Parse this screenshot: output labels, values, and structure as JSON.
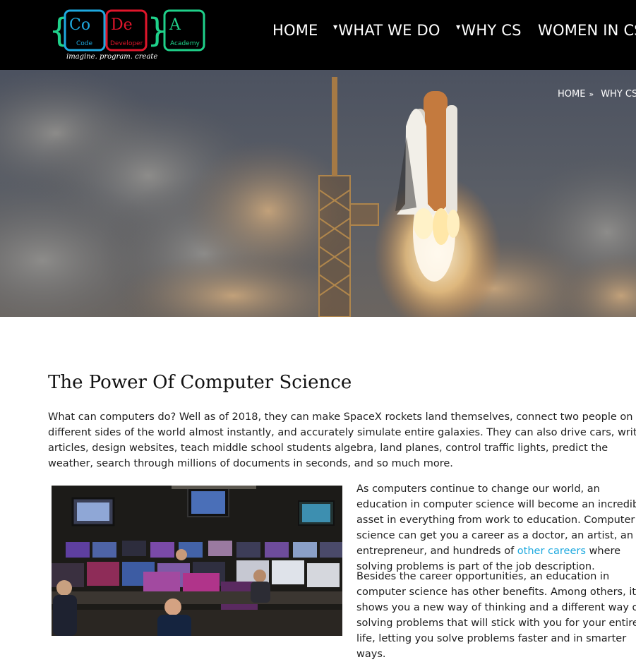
{
  "header": {
    "logo": {
      "tiles": [
        "Co",
        "De",
        "A"
      ],
      "tile_subtitles": [
        "Code",
        "Developer",
        "Academy"
      ],
      "tagline": "imagine. program. create",
      "colors": {
        "co": "#1ea9df",
        "de": "#e0162b",
        "a": "#1fd18a",
        "brace_left": "#1fd18a"
      }
    },
    "nav": [
      {
        "label": "HOME",
        "dropdown": false
      },
      {
        "label": "WHAT WE DO",
        "dropdown": true
      },
      {
        "label": "WHY CS",
        "dropdown": true
      },
      {
        "label": "WOMEN IN CS",
        "dropdown": false
      }
    ]
  },
  "hero": {
    "breadcrumb": [
      "HOME",
      "WHY CS"
    ],
    "breadcrumb_separator": "»"
  },
  "content": {
    "title": "The Power Of Computer Science",
    "intro": "What can computers do? Well as of 2018, they can make SpaceX rockets land themselves, connect two people on different sides of the world almost instantly, and accurately simulate entire galaxies. They can also drive cars, write articles, design websites, teach middle school students algebra, land planes, control traffic lights, predict the weather, search through millions of documents in seconds, and so much more.",
    "para1_before": "As computers continue to change our world, an education in computer science will become an incredible asset in everything from work to education. Computer science can get you a career as a doctor, an artist, an entrepreneur, and hundreds of ",
    "para1_link": "other careers",
    "para1_after": " where solving problems is part of the job description.",
    "para2": "Besides the career opportunities, an education in computer science has other benefits. Among others, it shows you a new way of thinking and a different way of solving problems that will stick with you for your entire life, letting you solve problems faster and in smarter ways.",
    "link_color": "#1ea9df"
  }
}
